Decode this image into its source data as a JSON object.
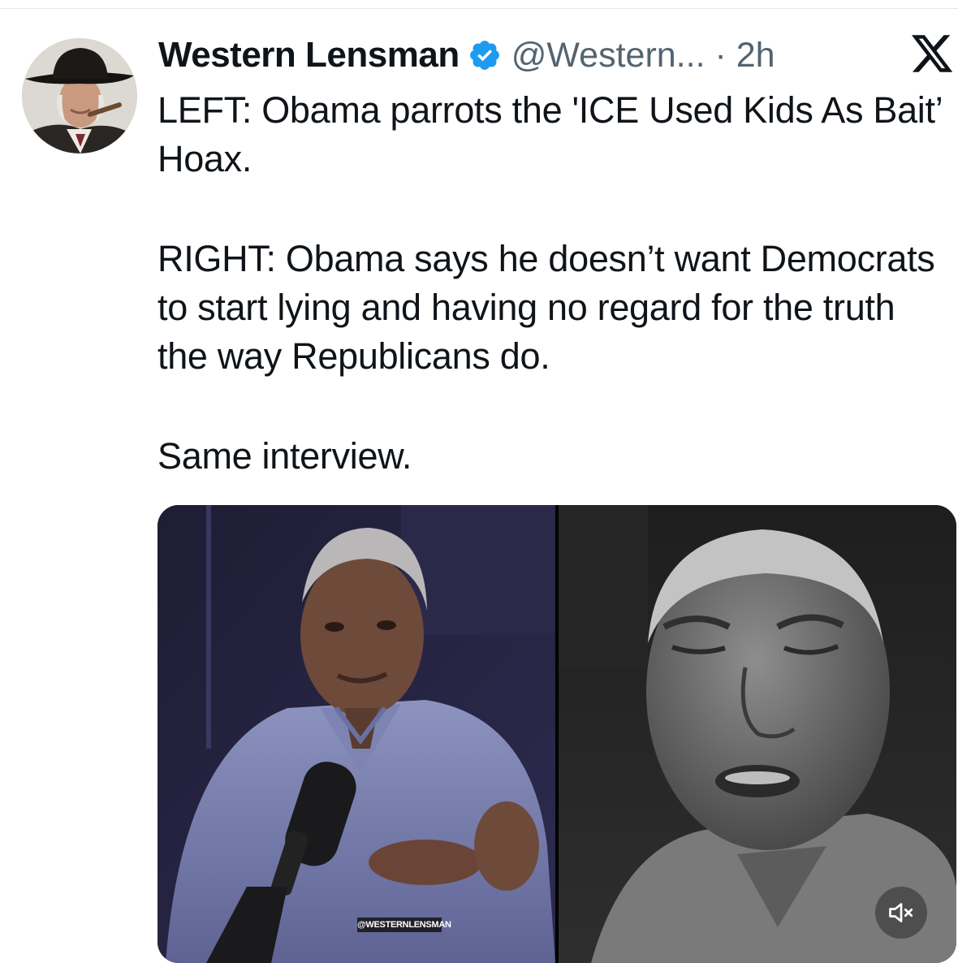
{
  "tweet": {
    "author_name": "Western Lensman",
    "handle": "@Western...",
    "separator": "·",
    "time": "2h",
    "text_lines": [
      "LEFT: Obama parrots the 'ICE Used Kids As Bait’ Hoax.",
      "RIGHT: Obama says he doesn’t want Democrats to start lying and having no regard for the truth the way Republicans do.",
      "Same interview."
    ]
  },
  "media": {
    "watermark": "@WESTERNLENSMAN",
    "muted": true
  },
  "icons": {
    "verified": "verified-badge-icon",
    "platform": "x-logo-icon",
    "mute": "speaker-muted-icon"
  },
  "colors": {
    "verified_blue": "#1d9bf0",
    "text": "#0f1419",
    "secondary_text": "#536471"
  }
}
